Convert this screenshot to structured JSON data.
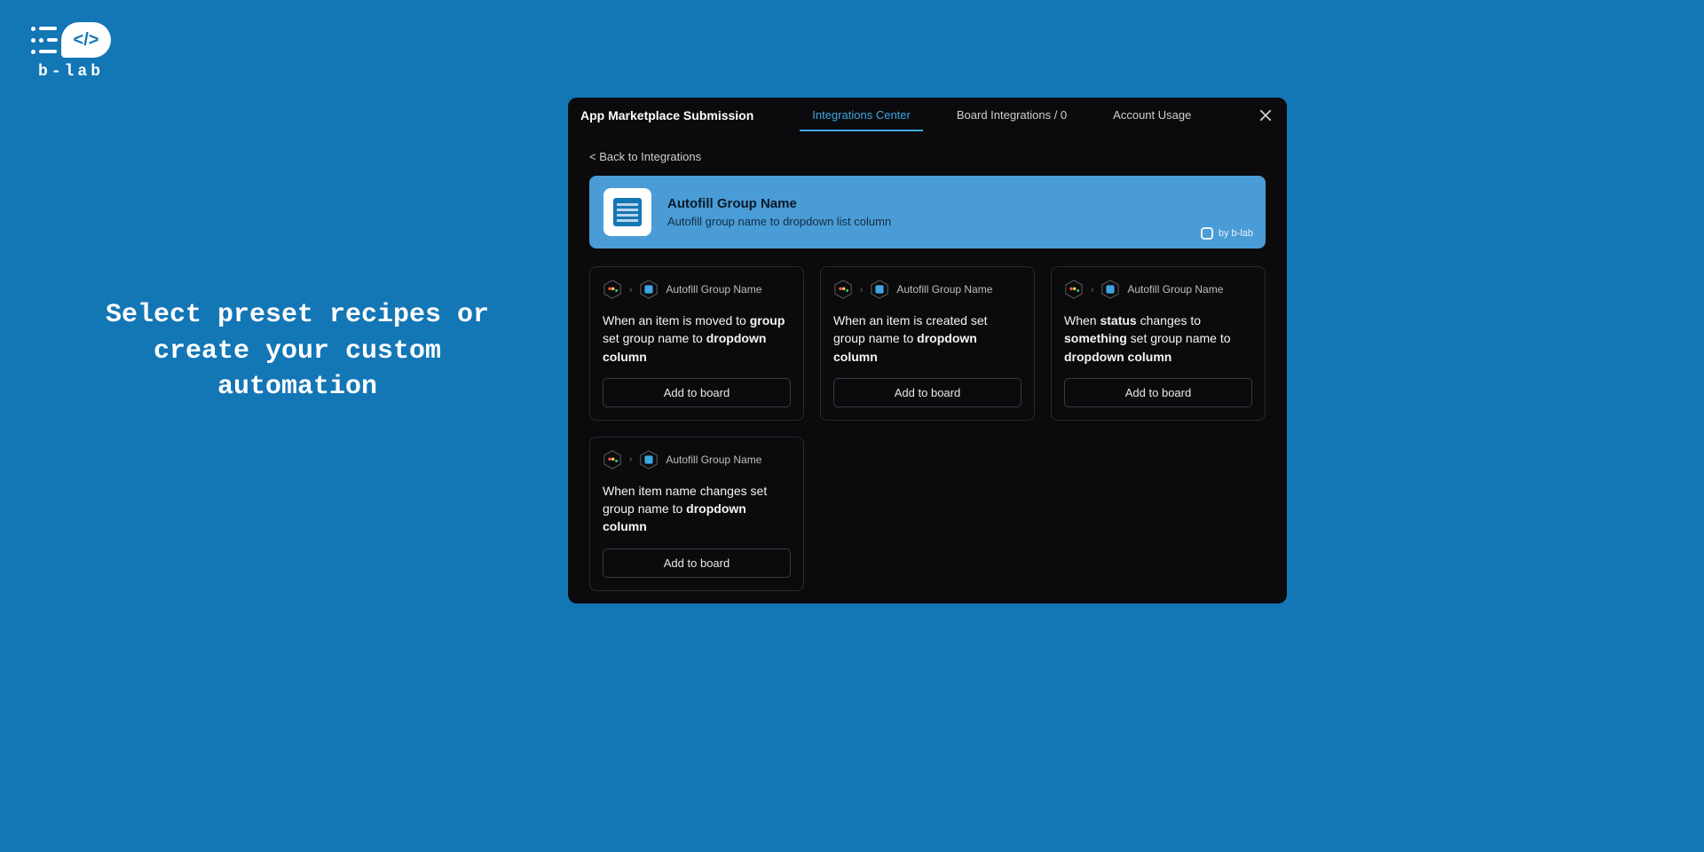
{
  "logo": {
    "glyph": "</>",
    "text": "b-lab"
  },
  "hero": "Select preset recipes or create your custom automation",
  "modal": {
    "title": "App Marketplace Submission",
    "tabs": [
      {
        "label": "Integrations Center",
        "active": true
      },
      {
        "label": "Board Integrations / 0",
        "active": false
      },
      {
        "label": "Account Usage",
        "active": false
      }
    ],
    "back": "< Back to Integrations"
  },
  "banner": {
    "title": "Autofill Group Name",
    "subtitle": "Autofill group name to dropdown list column",
    "credit": "by b-lab"
  },
  "recipe_label": "Autofill Group Name",
  "add_button": "Add to board",
  "recipes": [
    {
      "html": "When an item is moved to <b>group</b> set group name to <b>dropdown column</b>"
    },
    {
      "html": "When an item is created set group name to <b>dropdown column</b>"
    },
    {
      "html": "When <b>status</b> changes to <b>something</b> set group name to <b>dropdown column</b>"
    },
    {
      "html": "When item name changes set group name to <b>dropdown column</b>"
    }
  ]
}
